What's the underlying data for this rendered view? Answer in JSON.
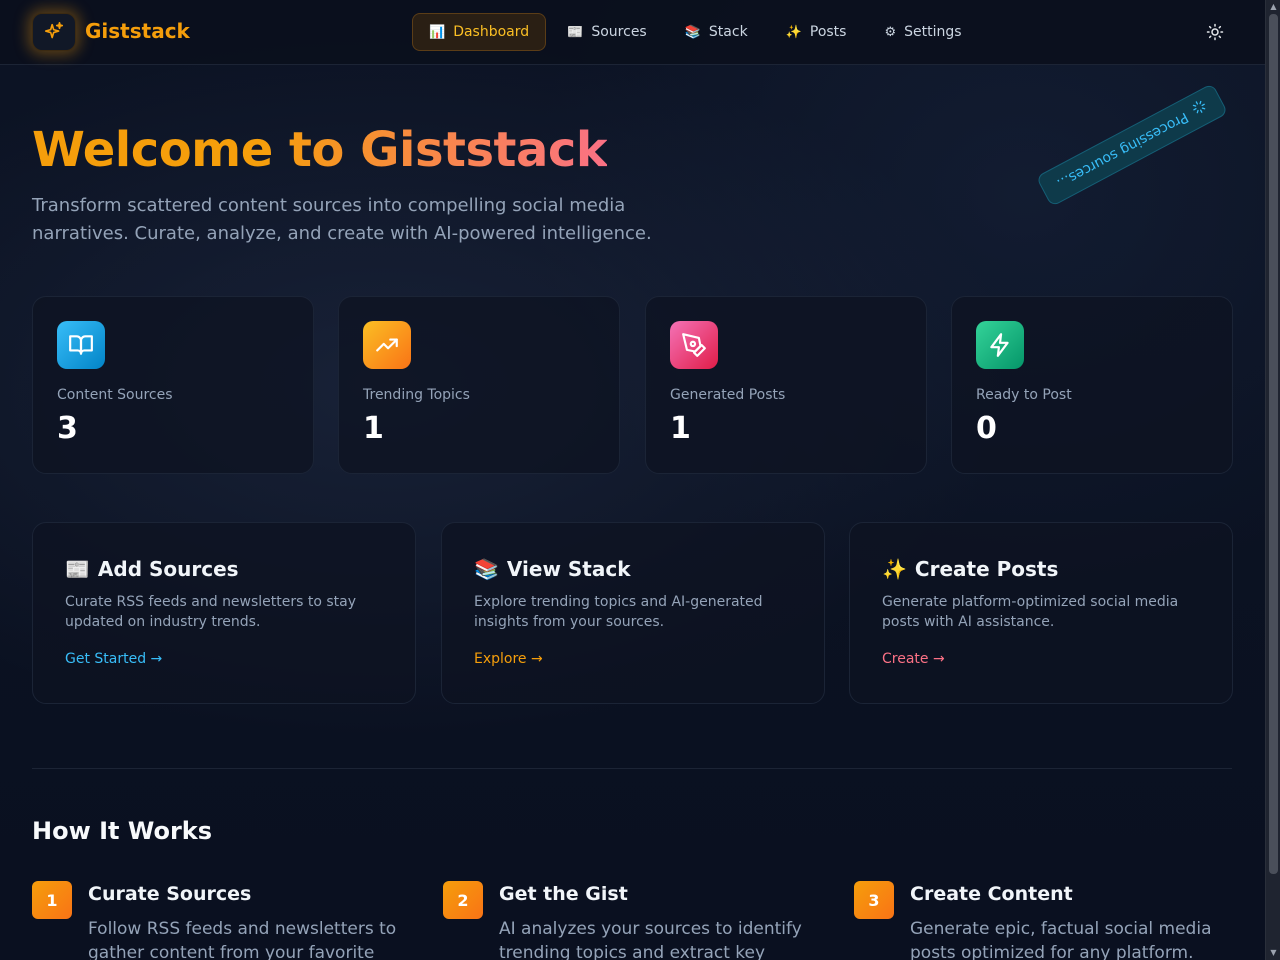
{
  "header": {
    "brand": "Giststack",
    "nav": [
      {
        "icon": "📊",
        "label": "Dashboard",
        "active": true
      },
      {
        "icon": "📰",
        "label": "Sources"
      },
      {
        "icon": "📚",
        "label": "Stack"
      },
      {
        "icon": "✨",
        "label": "Posts"
      },
      {
        "icon": "⚙",
        "label": "Settings"
      }
    ]
  },
  "hero": {
    "title": "Welcome to Giststack",
    "subtitle": "Transform scattered content sources into compelling social media narratives. Curate, analyze, and create with AI-powered intelligence.",
    "status": "Processing sources..."
  },
  "stats": [
    {
      "label": "Content Sources",
      "value": "3",
      "icon": "book-icon",
      "color": "#0ea5e9"
    },
    {
      "label": "Trending Topics",
      "value": "1",
      "icon": "trending-icon",
      "color": "#f59e0b"
    },
    {
      "label": "Generated Posts",
      "value": "1",
      "icon": "pen-icon",
      "color": "#ec4899"
    },
    {
      "label": "Ready to Post",
      "value": "0",
      "icon": "lightning-icon",
      "color": "#10b981"
    }
  ],
  "actions": [
    {
      "icon": "📰",
      "title": "Add Sources",
      "desc": "Curate RSS feeds and newsletters to stay updated on industry trends.",
      "link": "Get Started →",
      "link_color": "#38bdf8"
    },
    {
      "icon": "📚",
      "title": "View Stack",
      "desc": "Explore trending topics and AI-generated insights from your sources.",
      "link": "Explore →",
      "link_color": "#f59e0b"
    },
    {
      "icon": "✨",
      "title": "Create Posts",
      "desc": "Generate platform-optimized social media posts with AI assistance.",
      "link": "Create →",
      "link_color": "#fb7185"
    }
  ],
  "how": {
    "title": "How It Works",
    "steps": [
      {
        "num": "1",
        "title": "Curate Sources",
        "desc": "Follow RSS feeds and newsletters to gather content from your favorite"
      },
      {
        "num": "2",
        "title": "Get the Gist",
        "desc": "AI analyzes your sources to identify trending topics and extract key insights."
      },
      {
        "num": "3",
        "title": "Create Content",
        "desc": "Generate epic, factual social media posts optimized for any platform."
      }
    ]
  }
}
